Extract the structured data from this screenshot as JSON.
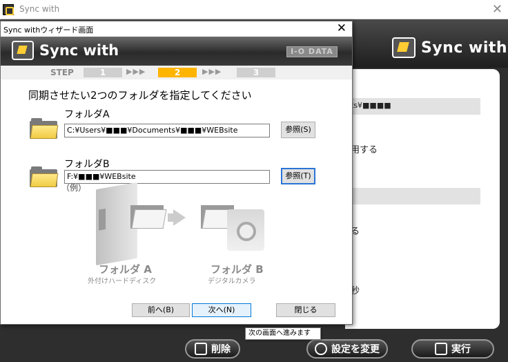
{
  "main_window": {
    "title": "Sync with",
    "brand": "Sync with",
    "panel_texts": [
      "ts¥■■■■",
      "用する",
      "る",
      "秒"
    ]
  },
  "bottom_buttons": {
    "delete": "削除",
    "settings": "設定を変更",
    "run": "実行"
  },
  "wizard": {
    "title": "Sync withウィザード画面",
    "brand": "Sync with",
    "maker_logo": "I-O DATA",
    "steps": {
      "label": "STEP",
      "items": [
        "1",
        "2",
        "3"
      ],
      "arrows": "▶▶▶",
      "active_index": 1
    },
    "instruction": "同期させたい2つのフォルダを指定してください",
    "folder_a": {
      "label": "フォルダA",
      "path": "C:¥Users¥■■■¥Documents¥■■■¥WEBsite",
      "browse_label": "参照(S)"
    },
    "folder_b": {
      "label": "フォルダB",
      "path": "F:¥■■■¥WEBsite",
      "browse_label": "参照(T)"
    },
    "example": {
      "label": "（例）",
      "folder_a_caption": "フォルダ A",
      "folder_a_sub": "外付けハードディスク",
      "folder_b_caption": "フォルダ B",
      "folder_b_sub": "デジタルカメラ"
    },
    "buttons": {
      "back": "前へ(B)",
      "next": "次へ(N)",
      "close": "閉じる"
    },
    "tooltip": "次の画面へ進みます"
  },
  "colors": {
    "step_active": "#ffb400",
    "step_inactive": "#cfcfcf",
    "folder_yellow": "#f0cc44",
    "focus_blue": "#2a74d6"
  }
}
